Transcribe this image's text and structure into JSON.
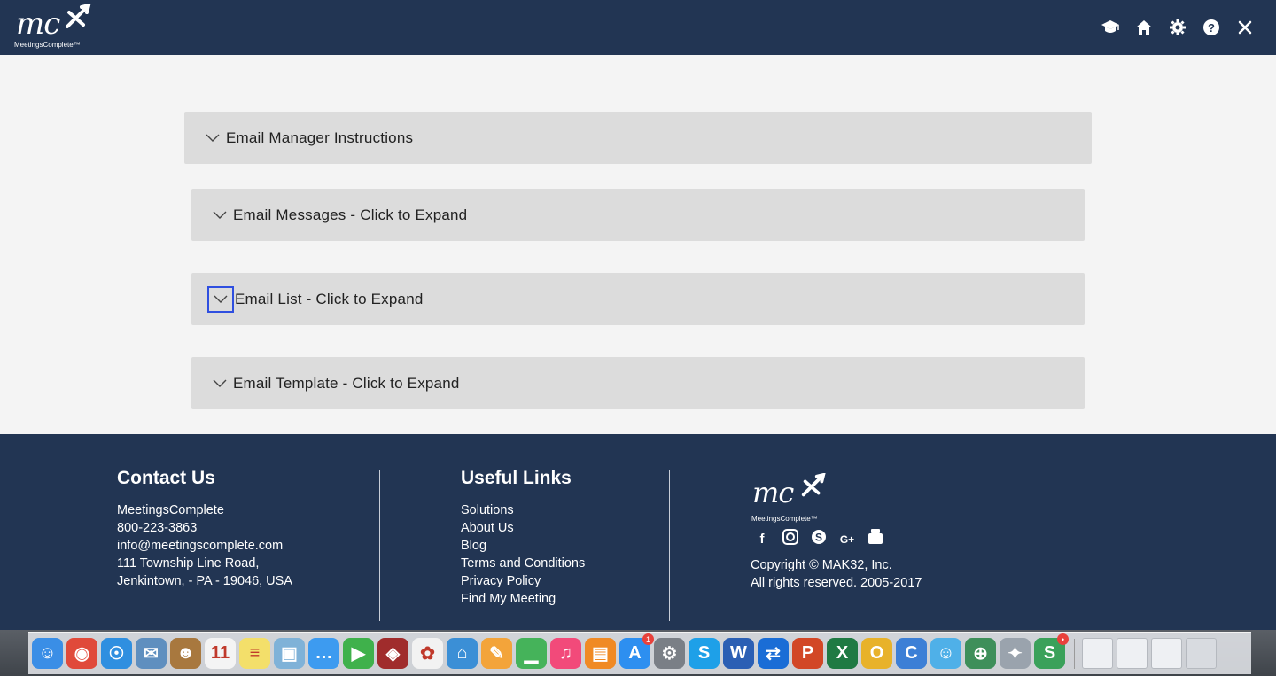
{
  "header": {
    "logo_text": "mc",
    "brand": "MeetingsComplete™",
    "icons": [
      "graduation-cap-icon",
      "home-icon",
      "gear-icon",
      "help-icon",
      "close-icon"
    ]
  },
  "panels": [
    {
      "label": "Email Manager Instructions"
    },
    {
      "label": "Email Messages - Click to Expand"
    },
    {
      "label": "Email List - Click to Expand"
    },
    {
      "label": "Email Template - Click to Expand"
    }
  ],
  "footer": {
    "contact": {
      "title": "Contact Us",
      "lines": [
        "MeetingsComplete",
        "800-223-3863",
        "info@meetingscomplete.com",
        "111 Township Line Road,",
        "Jenkintown, - PA - 19046, USA"
      ]
    },
    "links": {
      "title": "Useful Links",
      "items": [
        "Solutions",
        "About Us",
        "Blog",
        "Terms and Conditions",
        "Privacy Policy",
        "Find My Meeting"
      ]
    },
    "brand": {
      "logo_text": "mc",
      "brand": "MeetingsComplete™",
      "social": [
        "facebook-icon",
        "instagram-icon",
        "skype-icon",
        "google-plus-icon",
        "youtube-icon"
      ],
      "copyright": "Copyright © MAK32, Inc.",
      "rights": "All rights reserved. 2005-2017"
    }
  },
  "dock": {
    "apps": [
      {
        "name": "finder-icon",
        "color": "#3a8ee6",
        "glyph": "☺",
        "badge": ""
      },
      {
        "name": "chrome-icon",
        "color": "#e04a3a",
        "glyph": "◉",
        "badge": ""
      },
      {
        "name": "safari-icon",
        "color": "#2f8fe0",
        "glyph": "☉",
        "badge": ""
      },
      {
        "name": "mail-stamp-icon",
        "color": "#5f8fbf",
        "glyph": "✉",
        "badge": ""
      },
      {
        "name": "contacts-icon",
        "color": "#a8783e",
        "glyph": "☻",
        "badge": ""
      },
      {
        "name": "calendar-icon",
        "color": "#f4f4f4",
        "glyph": "11",
        "badge": ""
      },
      {
        "name": "notes-icon",
        "color": "#f3df6a",
        "glyph": "≡",
        "badge": ""
      },
      {
        "name": "preview-icon",
        "color": "#7fb2d8",
        "glyph": "▣",
        "badge": ""
      },
      {
        "name": "messages-icon",
        "color": "#3d9bf0",
        "glyph": "…",
        "badge": ""
      },
      {
        "name": "facetime-icon",
        "color": "#3fb14b",
        "glyph": "▶",
        "badge": ""
      },
      {
        "name": "photo-booth-icon",
        "color": "#a02c2c",
        "glyph": "◈",
        "badge": ""
      },
      {
        "name": "photos-icon",
        "color": "#f2f2f2",
        "glyph": "✿",
        "badge": ""
      },
      {
        "name": "keynote-icon",
        "color": "#3b8fd6",
        "glyph": "⌂",
        "badge": ""
      },
      {
        "name": "pages-icon",
        "color": "#f3a43a",
        "glyph": "✎",
        "badge": ""
      },
      {
        "name": "numbers-icon",
        "color": "#45b35a",
        "glyph": "▁",
        "badge": ""
      },
      {
        "name": "itunes-icon",
        "color": "#f24a7a",
        "glyph": "♫",
        "badge": ""
      },
      {
        "name": "ibooks-icon",
        "color": "#f08a24",
        "glyph": "▤",
        "badge": ""
      },
      {
        "name": "app-store-icon",
        "color": "#2d8ff0",
        "glyph": "A",
        "badge": "1"
      },
      {
        "name": "system-preferences-icon",
        "color": "#7a7f86",
        "glyph": "⚙",
        "badge": ""
      },
      {
        "name": "skype-icon",
        "color": "#1ea0e8",
        "glyph": "S",
        "badge": ""
      },
      {
        "name": "word-icon",
        "color": "#2b5fb4",
        "glyph": "W",
        "badge": ""
      },
      {
        "name": "teamviewer-icon",
        "color": "#1a6dd6",
        "glyph": "⇄",
        "badge": ""
      },
      {
        "name": "powerpoint-icon",
        "color": "#d24726",
        "glyph": "P",
        "badge": ""
      },
      {
        "name": "excel-icon",
        "color": "#1f7a43",
        "glyph": "X",
        "badge": ""
      },
      {
        "name": "outlook-icon",
        "color": "#e8b22a",
        "glyph": "O",
        "badge": ""
      },
      {
        "name": "c-app-icon",
        "color": "#3c7fd6",
        "glyph": "C",
        "badge": ""
      },
      {
        "name": "people-icon",
        "color": "#4fb0e8",
        "glyph": "☺",
        "badge": ""
      },
      {
        "name": "network-globe-icon",
        "color": "#3e8f5a",
        "glyph": "⊕",
        "badge": ""
      },
      {
        "name": "satellite-icon",
        "color": "#9aa3ad",
        "glyph": "✦",
        "badge": ""
      },
      {
        "name": "slack-like-icon",
        "color": "#3aa15a",
        "glyph": "S",
        "badge": "•"
      }
    ],
    "docs": [
      {
        "name": "document-stack-icon-1",
        "color": "#eef0f3"
      },
      {
        "name": "document-stack-icon-2",
        "color": "#eef0f3"
      },
      {
        "name": "document-stack-icon-3",
        "color": "#eef0f3"
      },
      {
        "name": "trash-icon",
        "color": "#d8dbe0"
      }
    ]
  }
}
